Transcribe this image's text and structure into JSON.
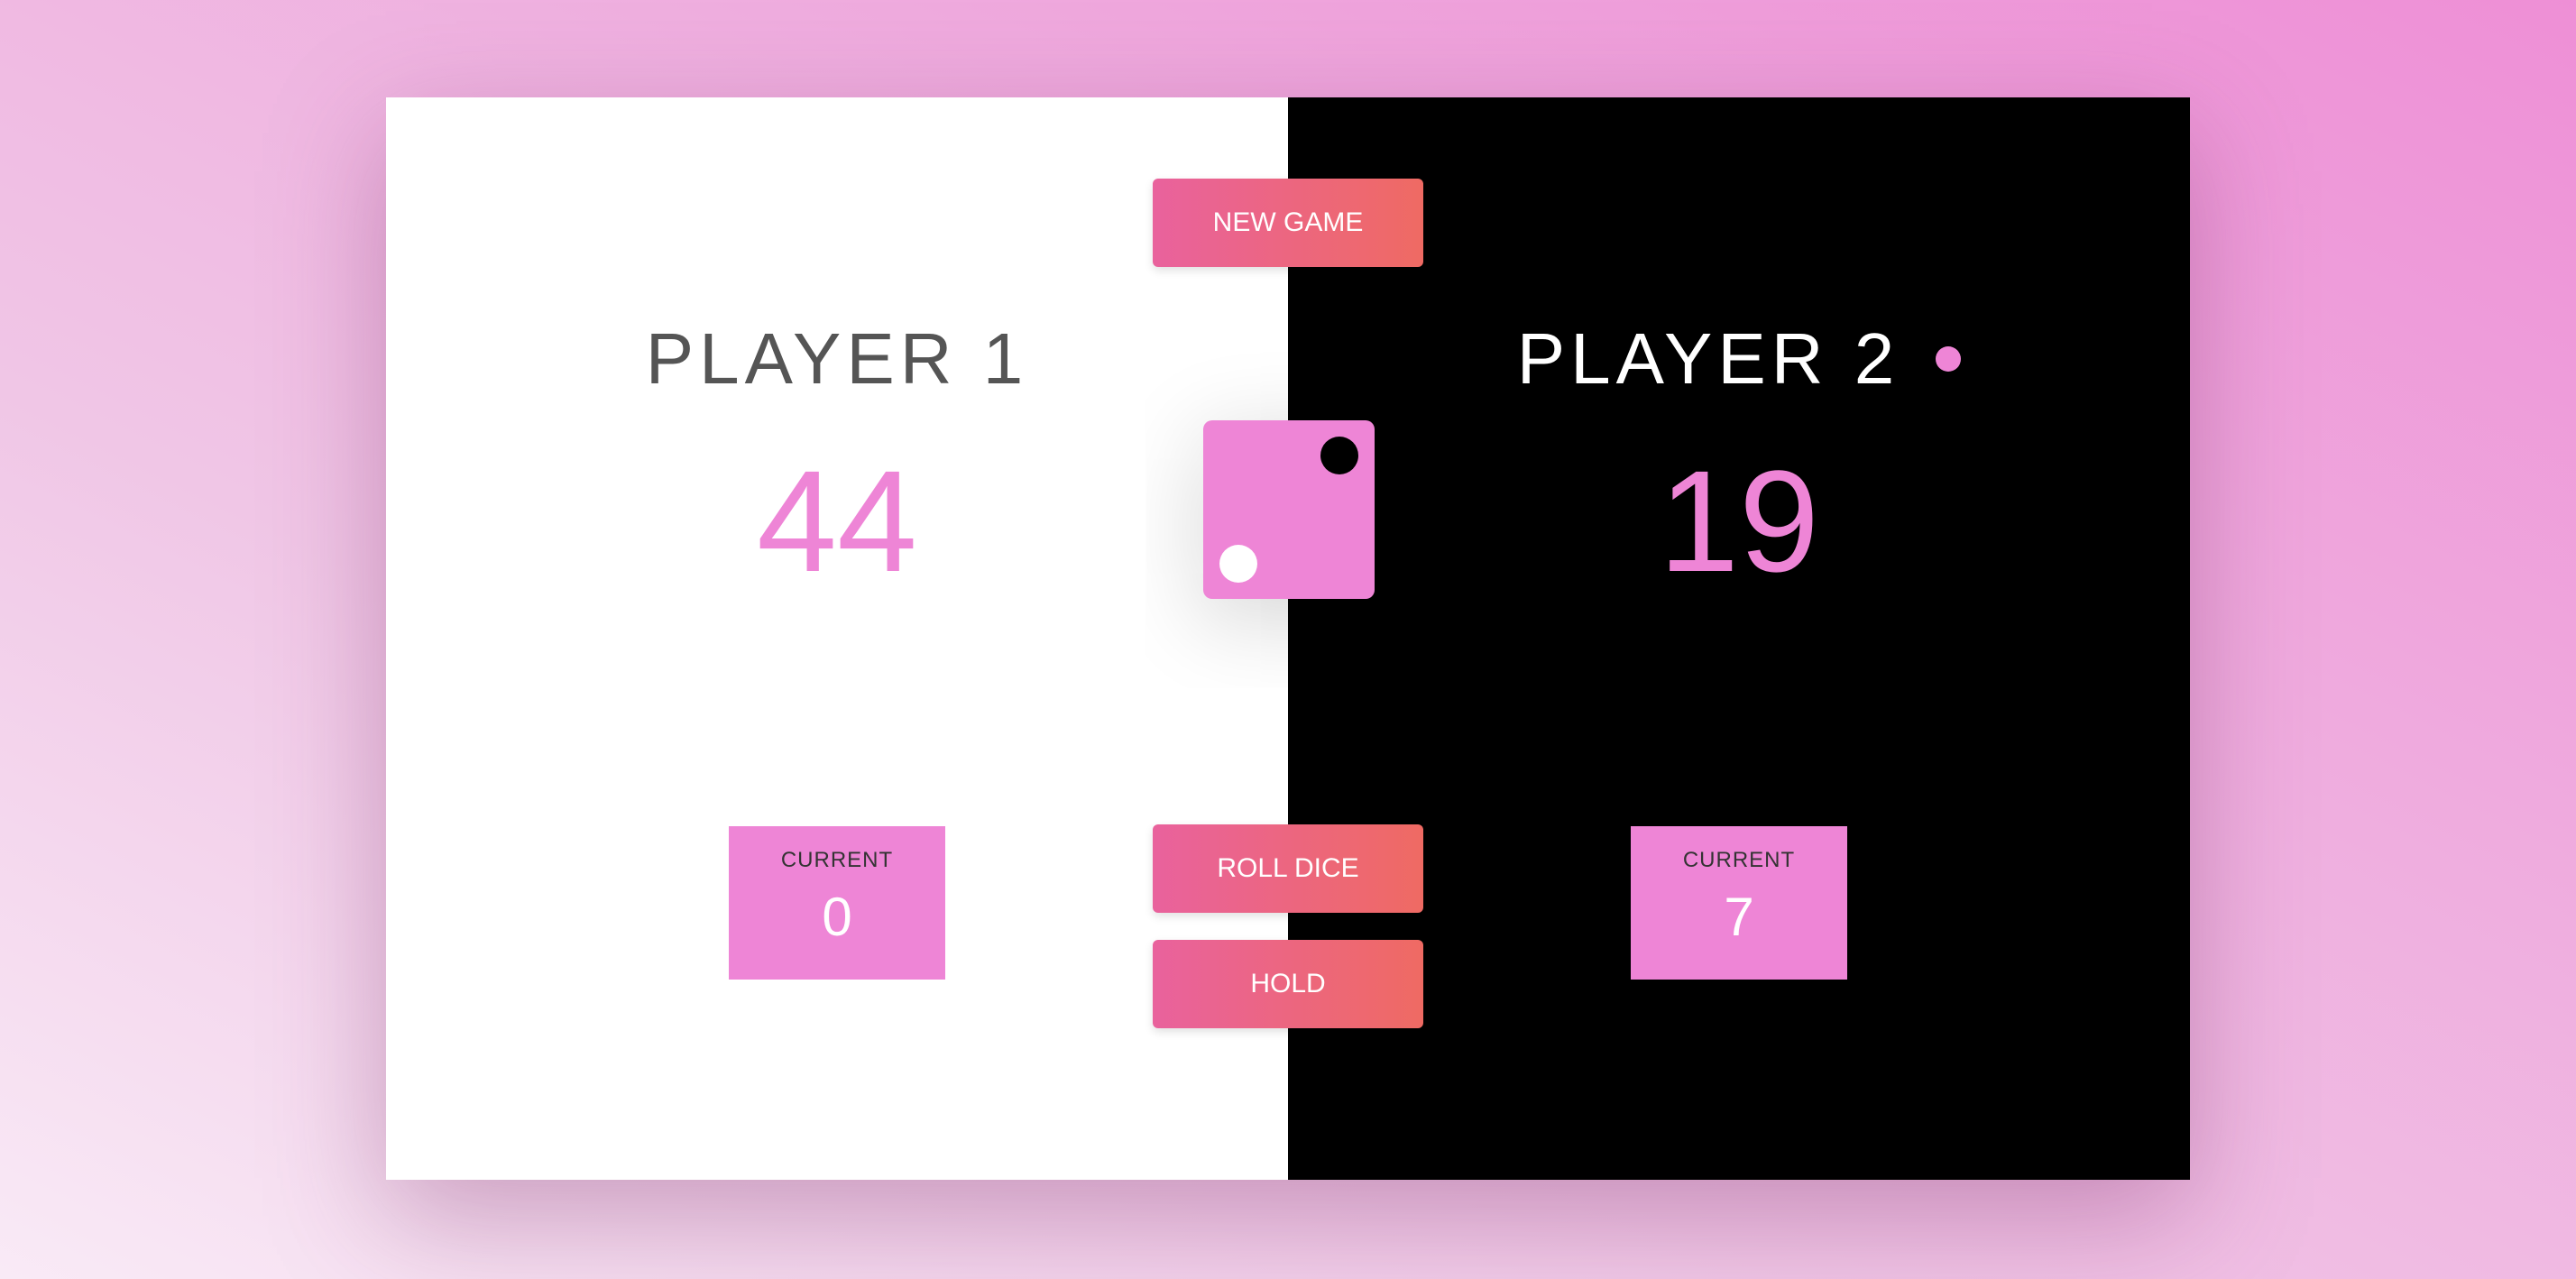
{
  "colors": {
    "accent": "#ee85d6",
    "button_start": "#e9629d",
    "button_end": "#ef6a63",
    "panel_light": "#ffffff",
    "panel_dark": "#000000"
  },
  "buttons": {
    "new_game": "NEW GAME",
    "roll_dice": "ROLL DICE",
    "hold": "HOLD"
  },
  "players": [
    {
      "name": "PLAYER 1",
      "score": "44",
      "current_label": "CURRENT",
      "current_score": "0",
      "active": false
    },
    {
      "name": "PLAYER 2",
      "score": "19",
      "current_label": "CURRENT",
      "current_score": "7",
      "active": true
    }
  ],
  "dice": {
    "value": 2,
    "icon": "dice-two-icon"
  }
}
